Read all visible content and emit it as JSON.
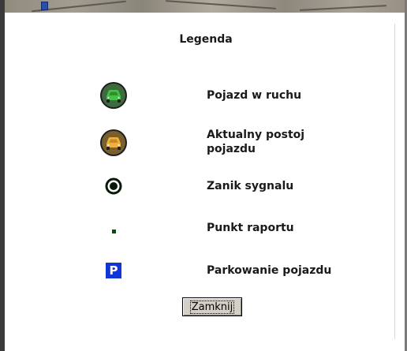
{
  "dialog": {
    "title": "Legenda",
    "close_label": "Zamknij",
    "items": [
      {
        "icon": "moving-vehicle-icon",
        "label": "Pojazd w ruchu",
        "color": "#3fae3f"
      },
      {
        "icon": "stopped-vehicle-icon",
        "label": "Aktualny postoj\npojazdu",
        "color": "#e8a83a"
      },
      {
        "icon": "signal-loss-icon",
        "label": "Zanik sygnalu",
        "color": "#0a3a0a"
      },
      {
        "icon": "report-point-icon",
        "label": "Punkt raportu",
        "color": "#0a4a0a"
      },
      {
        "icon": "parking-icon",
        "label": "Parkowanie pojazdu",
        "glyph": "P",
        "color": "#1236d6"
      }
    ]
  }
}
